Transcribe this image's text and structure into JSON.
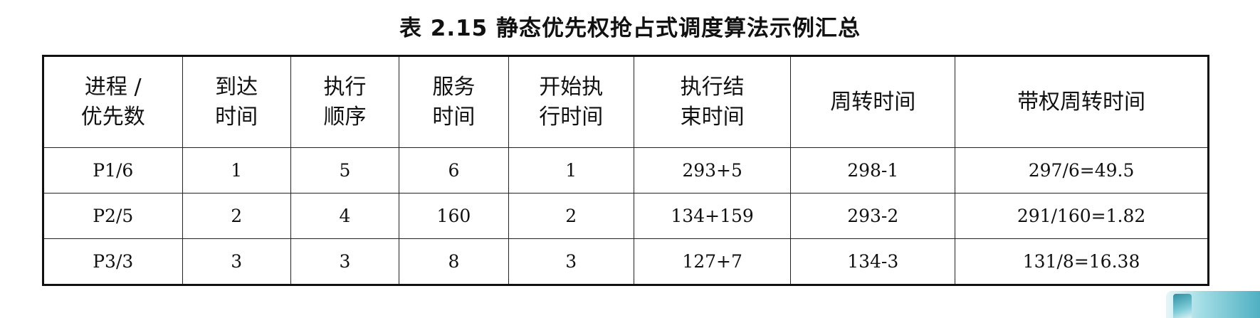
{
  "caption": "表 2.15 静态优先权抢占式调度算法示例汇总",
  "table": {
    "headers": [
      [
        "进程 /",
        "优先数"
      ],
      [
        "到达",
        "时间"
      ],
      [
        "执行",
        "顺序"
      ],
      [
        "服务",
        "时间"
      ],
      [
        "开始执",
        "行时间"
      ],
      [
        "执行结",
        "束时间"
      ],
      [
        "周转时间"
      ],
      [
        "带权周转时间"
      ]
    ],
    "rows": [
      [
        "P1/6",
        "1",
        "5",
        "6",
        "1",
        "293+5",
        "298-1",
        "297/6=49.5"
      ],
      [
        "P2/5",
        "2",
        "4",
        "160",
        "2",
        "134+159",
        "293-2",
        "291/160=1.82"
      ],
      [
        "P3/3",
        "3",
        "3",
        "8",
        "3",
        "127+7",
        "134-3",
        "131/8=16.38"
      ]
    ]
  }
}
